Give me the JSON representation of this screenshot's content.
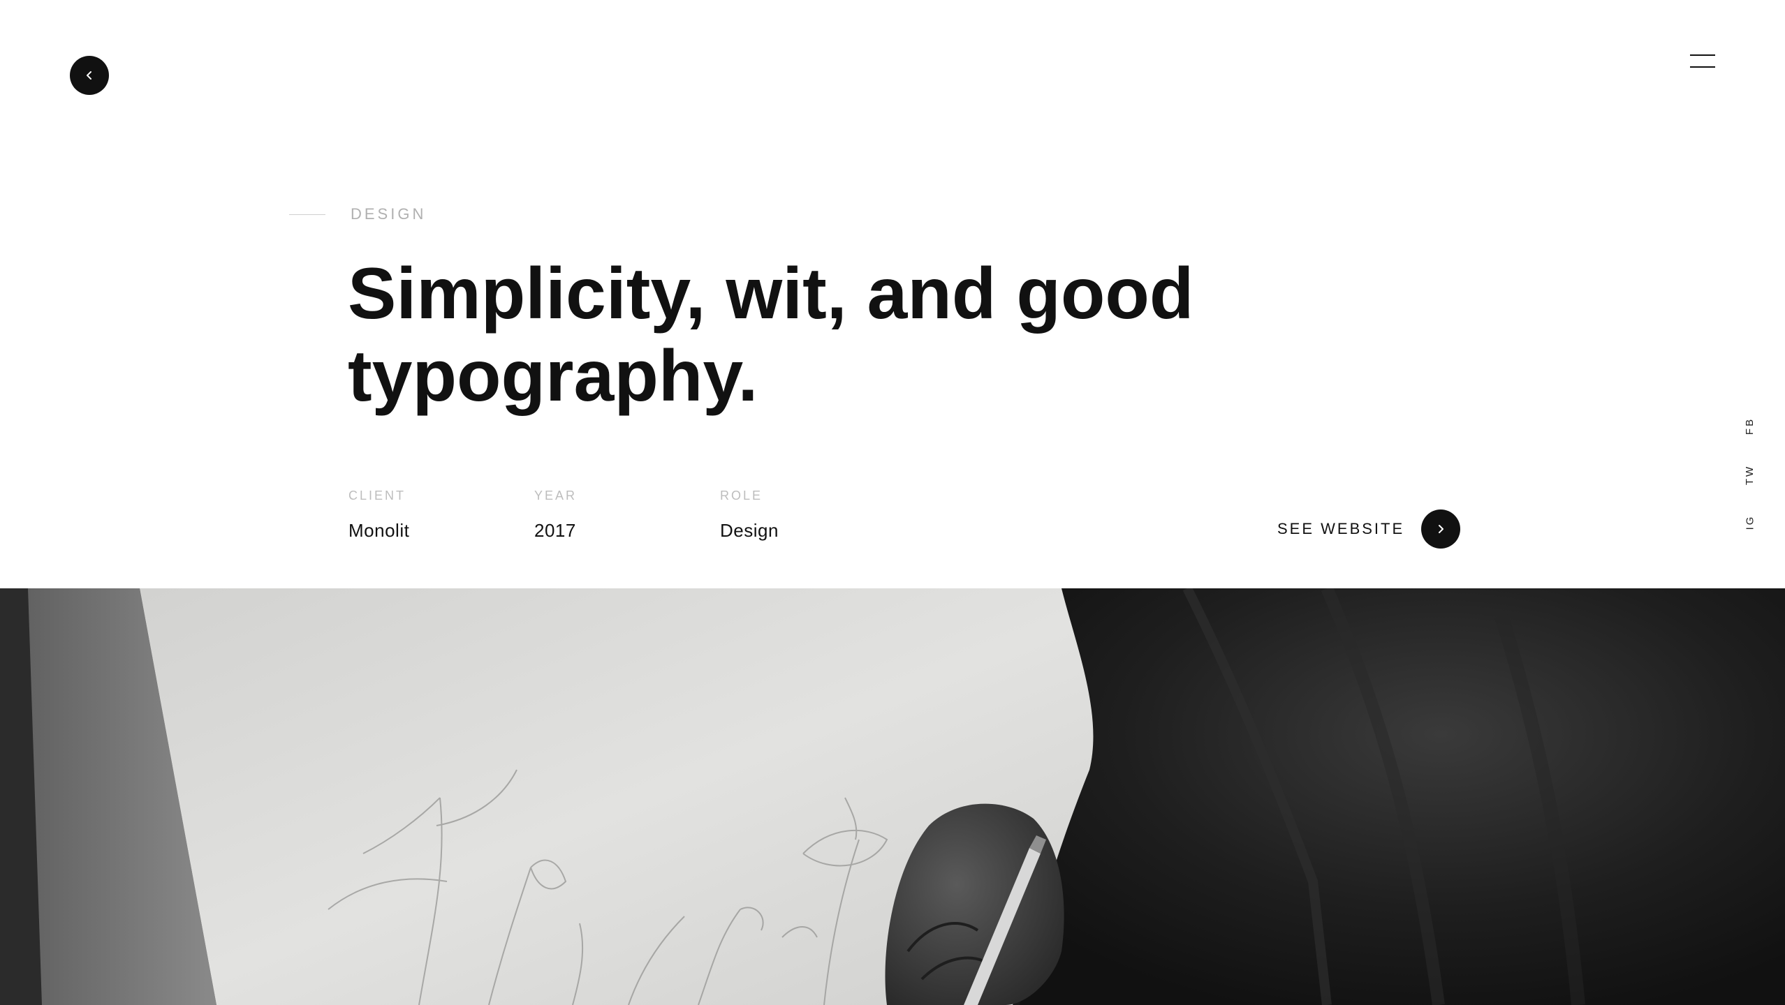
{
  "nav": {
    "back_icon": "chevron-left-icon",
    "menu_icon": "hamburger-menu-icon"
  },
  "project": {
    "category": "DESIGN",
    "title_line1": "Simplicity, wit, and good",
    "title_line2": "typography.",
    "meta": {
      "client_label": "CLIENT",
      "client_value": "Monolit",
      "year_label": "YEAR",
      "year_value": "2017",
      "role_label": "ROLE",
      "role_value": "Design"
    },
    "cta": {
      "label": "SEE WEBSITE",
      "icon": "chevron-right-icon"
    }
  },
  "social": {
    "items": [
      {
        "label": "FB"
      },
      {
        "label": "TW"
      },
      {
        "label": "IG"
      }
    ]
  },
  "hero": {
    "image": "black-and-white photo of a hand drawing botanical sketches with a pen on paper"
  },
  "colors": {
    "text": "#111111",
    "muted": "#b0b0b0",
    "accent": "#111111",
    "background": "#ffffff"
  }
}
